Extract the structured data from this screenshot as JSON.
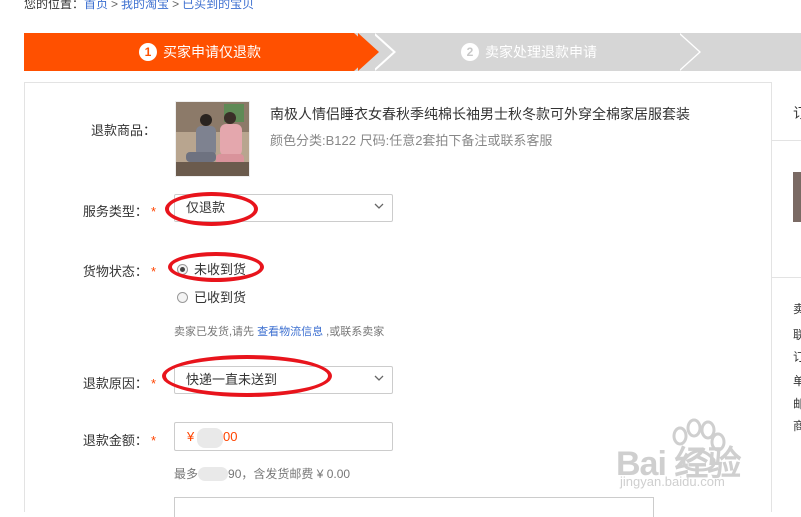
{
  "breadcrumb": {
    "prefix": "您的位置：",
    "items": [
      "首页",
      "我的淘宝",
      "已买到的宝贝"
    ],
    "separator": ">"
  },
  "steps": [
    {
      "num": "1",
      "label": "买家申请仅退款",
      "active": true
    },
    {
      "num": "2",
      "label": "卖家处理退款申请",
      "active": false
    }
  ],
  "form": {
    "product": {
      "label": "退款商品：",
      "title": "南极人情侣睡衣女春秋季纯棉长袖男士秋冬款可外穿全棉家居服套装",
      "sku": "颜色分类:B122   尺码:任意2套拍下备注或联系客服"
    },
    "service_type": {
      "label": "服务类型：",
      "required": "*",
      "value": "仅退款"
    },
    "goods_status": {
      "label": "货物状态：",
      "required": "*",
      "options": [
        {
          "label": "未收到货",
          "checked": true
        },
        {
          "label": "已收到货",
          "checked": false
        }
      ],
      "hint_before": "卖家已发货,请先 ",
      "hint_link": "查看物流信息",
      "hint_after": " ,或联系卖家"
    },
    "refund_reason": {
      "label": "退款原因：",
      "required": "*",
      "value": "快递一直未送到"
    },
    "refund_amount": {
      "label": "退款金额：",
      "required": "*",
      "currency": "¥",
      "value_tail": "00",
      "hint_prefix": "最多",
      "hint_tail": "90，含发货邮费 ¥ 0.00"
    }
  },
  "sidebar": {
    "texts": [
      "订",
      "卖",
      "联",
      "订",
      "单",
      "邮",
      "商"
    ]
  },
  "watermark": {
    "text": "Bai 经验",
    "sub": "jingyan.baidu.com"
  },
  "colors": {
    "accent": "#ff5000",
    "annotation": "#e8141c",
    "link": "#3c6fd0"
  }
}
